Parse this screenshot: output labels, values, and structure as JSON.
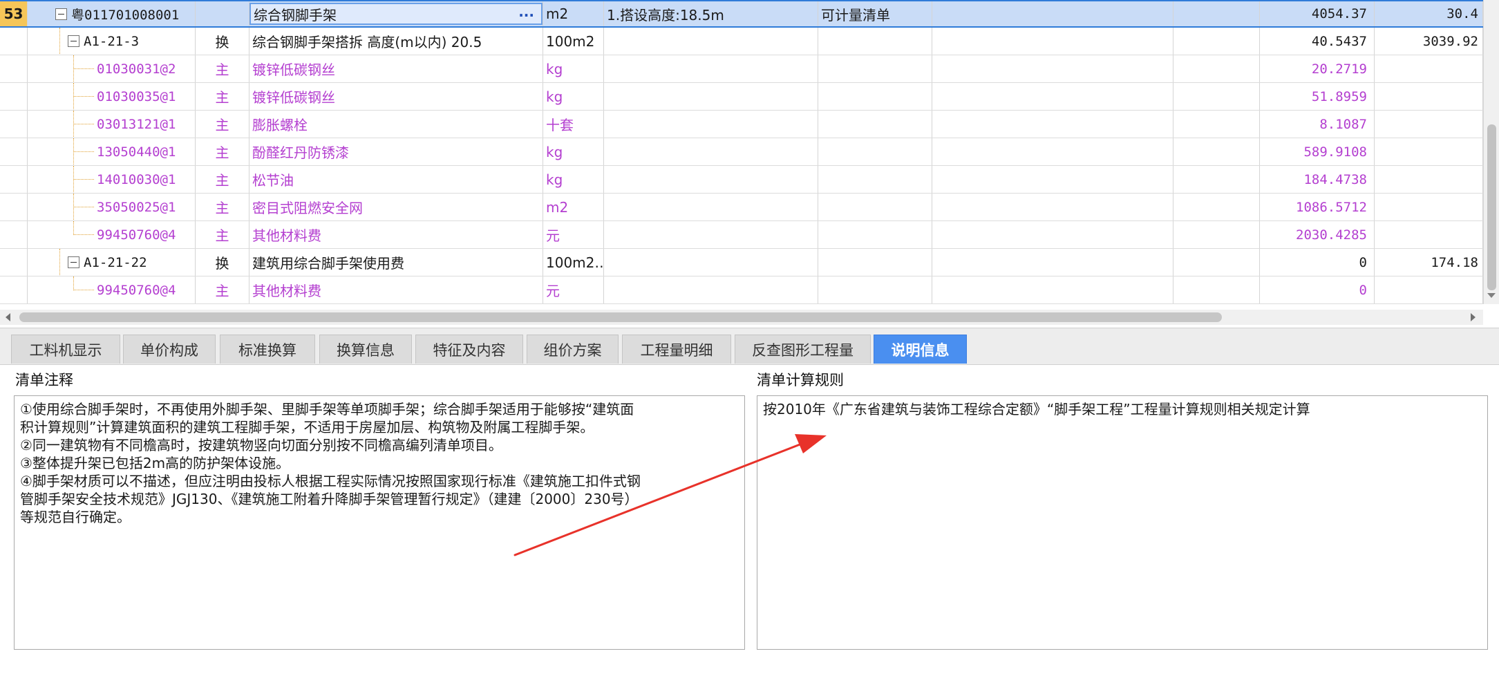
{
  "rows": [
    {
      "num": "53",
      "code": "粤011701008001",
      "type": "",
      "name": "综合钢脚手架",
      "unit": "m2",
      "expr": "1.搭设高度:18.5m",
      "category": "可计量清单",
      "qty": "4054.37",
      "price": "30.4"
    },
    {
      "num": "",
      "code": "A1-21-3",
      "type": "换",
      "name": "综合钢脚手架搭拆 高度(m以内) 20.5",
      "unit": "100m2",
      "expr": "",
      "category": "",
      "qty": "40.5437",
      "price": "3039.92"
    },
    {
      "num": "",
      "code": "01030031@2",
      "type": "主",
      "name": "镀锌低碳钢丝",
      "unit": "kg",
      "expr": "",
      "category": "",
      "qty": "20.2719",
      "price": ""
    },
    {
      "num": "",
      "code": "01030035@1",
      "type": "主",
      "name": "镀锌低碳钢丝",
      "unit": "kg",
      "expr": "",
      "category": "",
      "qty": "51.8959",
      "price": ""
    },
    {
      "num": "",
      "code": "03013121@1",
      "type": "主",
      "name": "膨胀螺栓",
      "unit": "十套",
      "expr": "",
      "category": "",
      "qty": "8.1087",
      "price": ""
    },
    {
      "num": "",
      "code": "13050440@1",
      "type": "主",
      "name": "酚醛红丹防锈漆",
      "unit": "kg",
      "expr": "",
      "category": "",
      "qty": "589.9108",
      "price": ""
    },
    {
      "num": "",
      "code": "14010030@1",
      "type": "主",
      "name": "松节油",
      "unit": "kg",
      "expr": "",
      "category": "",
      "qty": "184.4738",
      "price": ""
    },
    {
      "num": "",
      "code": "35050025@1",
      "type": "主",
      "name": "密目式阻燃安全网",
      "unit": "m2",
      "expr": "",
      "category": "",
      "qty": "1086.5712",
      "price": ""
    },
    {
      "num": "",
      "code": "99450760@4",
      "type": "主",
      "name": "其他材料费",
      "unit": "元",
      "expr": "",
      "category": "",
      "qty": "2030.4285",
      "price": ""
    },
    {
      "num": "",
      "code": "A1-21-22",
      "type": "换",
      "name": "建筑用综合脚手架使用费",
      "unit": "100m2…",
      "expr": "",
      "category": "",
      "qty": "0",
      "price": "174.18"
    },
    {
      "num": "",
      "code": "99450760@4",
      "type": "主",
      "name": "其他材料费",
      "unit": "元",
      "expr": "",
      "category": "",
      "qty": "0",
      "price": ""
    }
  ],
  "name_cell_more": "···",
  "tabs": [
    "工料机显示",
    "单价构成",
    "标准换算",
    "换算信息",
    "特征及内容",
    "组价方案",
    "工程量明细",
    "反查图形工程量",
    "说明信息"
  ],
  "active_tab": "说明信息",
  "panels": {
    "left_label": "清单注释",
    "left_text": "①使用综合脚手架时，不再使用外脚手架、里脚手架等单项脚手架；综合脚手架适用于能够按“建筑面\n积计算规则”计算建筑面积的建筑工程脚手架，不适用于房屋加层、构筑物及附属工程脚手架。\n②同一建筑物有不同檐高时，按建筑物竖向切面分别按不同檐高编列清单项目。\n③整体提升架已包括2m高的防护架体设施。\n④脚手架材质可以不描述，但应注明由投标人根据工程实际情况按照国家现行标准《建筑施工扣件式钢\n管脚手架安全技术规范》JGJ130、《建筑施工附着升降脚手架管理暂行规定》（建建〔2000〕230号）\n等规范自行确定。",
    "right_label": "清单计算规则",
    "right_text": "按2010年《广东省建筑与装饰工程综合定额》“脚手架工程”工程量计算规则相关规定计算"
  },
  "colors": {
    "accent": "#4a8ff0",
    "selected_row": "#c9dcf7",
    "row_number_bg": "#f6c659",
    "material_text": "#b43fd0",
    "arrow": "#e8322a"
  }
}
